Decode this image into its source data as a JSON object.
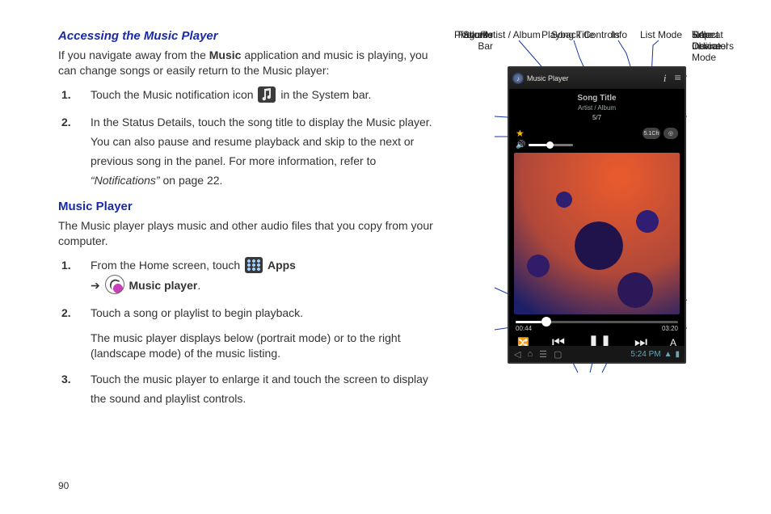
{
  "page_number": "90",
  "h1": "Accessing the Music Player",
  "intro1_a": "If you navigate away from the ",
  "intro1_bold": "Music",
  "intro1_b": " application and music is playing, you can change songs or easily return to the Music player:",
  "step1a_num": "1.",
  "step1a_a": "Touch the Music notification icon ",
  "step1a_b": " in the System bar.",
  "step2a_num": "2.",
  "step2a": "In the Status Details, touch the song title to display the Music player. You can also pause and resume playback and skip to the next or previous song in the panel. For more information, refer to ",
  "step2a_ref": "“Notifications”",
  "step2a_tail": "  on page 22.",
  "h2": "Music Player",
  "intro2": "The Music player plays music and other audio files that you copy from your computer.",
  "step1b_num": "1.",
  "step1b_a": "From the Home screen, touch ",
  "step1b_apps": "Apps",
  "step1b_arrow": "  ➔  ",
  "step1b_mp": "Music player",
  "step1b_period": ".",
  "step2b_num": "2.",
  "step2b": "Touch a song or playlist to begin playback.",
  "step2b_extra": "The music player displays below (portrait mode) or to the right (landscape mode) of the music listing.",
  "step3b_num": "3.",
  "step3b": "Touch the music player to enlarge it and touch the screen to display the sound and playlist controls.",
  "labels": {
    "artist_album": "Artist / Album",
    "song_title": "Song Title",
    "info": "Info",
    "list_mode": "List Mode",
    "select_device": "Select\nDevice",
    "ch51": "5.1\nChannel\nMode",
    "favorite": "Favorite",
    "volume": "Volume",
    "progress_bar": "Progress\nBar",
    "time_ind": "Time\nIndicators",
    "shuffle": "Shuffle",
    "repeat": "Repeat",
    "playback": "Playback Controls"
  },
  "player": {
    "app_title": "Music Player",
    "song_title": "Song Title",
    "artist_album": "Artist / Album",
    "track_counter": "5/7",
    "ch51_badge": "5.1Ch",
    "time_elapsed": "00:44",
    "time_total": "03:20",
    "repeat_glyph": "A",
    "clock": "5:24 PM",
    "info_glyph": "i",
    "list_glyph": "≡",
    "device_glyph": "◎"
  }
}
